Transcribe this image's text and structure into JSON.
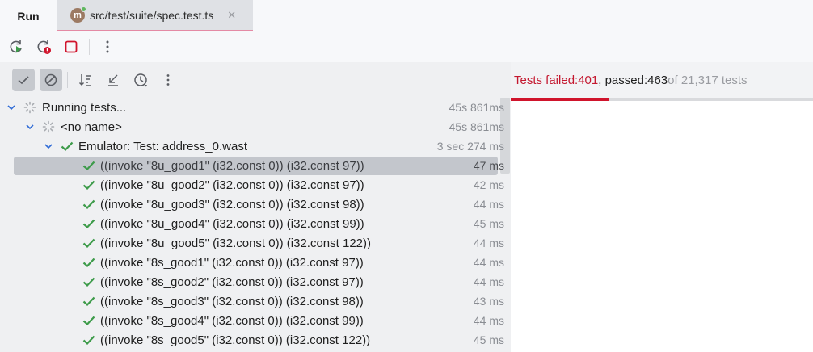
{
  "tabs": {
    "run_label": "Run",
    "file_icon_letter": "m",
    "file_label": "src/test/suite/spec.test.ts",
    "close_glyph": "✕"
  },
  "icons": {
    "rerun": "rerun-icon",
    "rerun_failed": "rerun-failed-icon",
    "stop": "stop-icon",
    "more": "more-vertical-icon",
    "show_passed": "check-icon",
    "show_ignored": "ignored-icon",
    "sort": "sort-icon",
    "collapse": "collapse-icon",
    "history": "clock-icon"
  },
  "colors": {
    "accent_fail": "#c4182f",
    "pass_green": "#3d9b4a",
    "stop_red": "#d0142c"
  },
  "tree": {
    "root": {
      "label": "Running tests...",
      "duration": "45s 861ms"
    },
    "group": {
      "label": "<no name>",
      "duration": "45s 861ms"
    },
    "suite": {
      "label": "Emulator: Test: address_0.wast",
      "duration": "3 sec 274 ms"
    },
    "tests": [
      {
        "label": "((invoke \"8u_good1\" (i32.const 0)) (i32.const 97))",
        "duration": "47 ms"
      },
      {
        "label": "((invoke \"8u_good2\" (i32.const 0)) (i32.const 97))",
        "duration": "42 ms"
      },
      {
        "label": "((invoke \"8u_good3\" (i32.const 0)) (i32.const 98))",
        "duration": "44 ms"
      },
      {
        "label": "((invoke \"8u_good4\" (i32.const 0)) (i32.const 99))",
        "duration": "45 ms"
      },
      {
        "label": "((invoke \"8u_good5\" (i32.const 0)) (i32.const 122))",
        "duration": "44 ms"
      },
      {
        "label": "((invoke \"8s_good1\" (i32.const 0)) (i32.const 97))",
        "duration": "44 ms"
      },
      {
        "label": "((invoke \"8s_good2\" (i32.const 0)) (i32.const 97))",
        "duration": "44 ms"
      },
      {
        "label": "((invoke \"8s_good3\" (i32.const 0)) (i32.const 98))",
        "duration": "43 ms"
      },
      {
        "label": "((invoke \"8s_good4\" (i32.const 0)) (i32.const 99))",
        "duration": "44 ms"
      },
      {
        "label": "((invoke \"8s_good5\" (i32.const 0)) (i32.const 122))",
        "duration": "45 ms"
      }
    ]
  },
  "summary": {
    "failed_prefix": "Tests failed: ",
    "failed_count": "401",
    "passed_prefix": ", passed: ",
    "passed_count": "463",
    "of_text": " of 21,317 tests",
    "progress_failed_fraction": 0.327
  }
}
